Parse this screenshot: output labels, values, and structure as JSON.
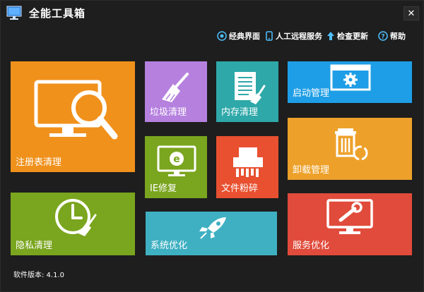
{
  "window": {
    "title": "全能工具箱",
    "close_label": "✕"
  },
  "toolbar": {
    "classic": "经典界面",
    "remote": "人工远程服务",
    "update": "检查更新",
    "help": "帮助"
  },
  "tiles": {
    "registry": "注册表清理",
    "junk": "垃圾清理",
    "memory": "内存清理",
    "startup": "启动管理",
    "ie": "IE修复",
    "shred": "文件粉碎",
    "uninstall": "卸载管理",
    "privacy": "隐私清理",
    "optimize": "系统优化",
    "service": "服务优化"
  },
  "footer": {
    "version": "软件版本: 4.1.0"
  },
  "colors": {
    "orange": "#f0911c",
    "purple": "#b580de",
    "teal": "#2ea8a8",
    "blue": "#1e9ee6",
    "green": "#7aa51e",
    "red_orange": "#e8502f",
    "gold": "#eda12a",
    "cyan": "#3fb0c2",
    "red": "#e14b3b"
  }
}
